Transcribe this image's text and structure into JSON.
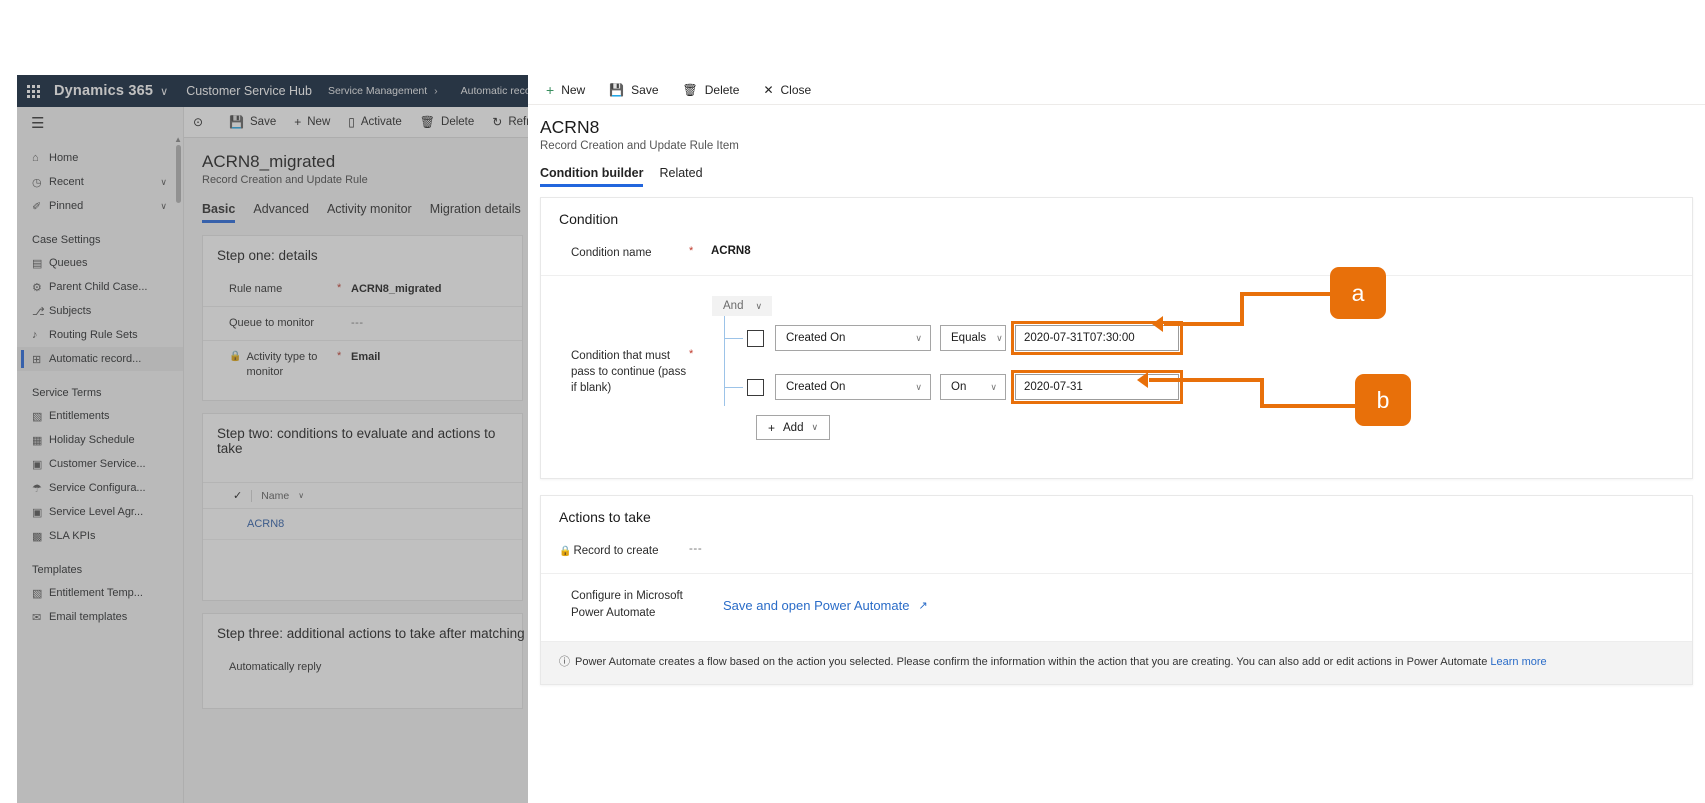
{
  "background_app": {
    "topbar": {
      "waffle_icon": "app-launcher-icon",
      "brand": "Dynamics 365",
      "brand_chevron": "∨",
      "app_name": "Customer Service Hub",
      "breadcrumb_parent": "Service Management",
      "breadcrumb_sep": "›",
      "breadcrumb_current": "Automatic record creation"
    },
    "sidebar": {
      "hamburger_icon": "hamburger-menu-icon",
      "items": [
        {
          "label": "Home",
          "icon": "⌂",
          "chevron": ""
        },
        {
          "label": "Recent",
          "icon": "◷",
          "chevron": "∨"
        },
        {
          "label": "Pinned",
          "icon": "✐",
          "chevron": "∨"
        }
      ],
      "groups": [
        {
          "title": "Case Settings",
          "items": [
            {
              "label": "Queues",
              "icon": "▤"
            },
            {
              "label": "Parent Child Case...",
              "icon": "⚙"
            },
            {
              "label": "Subjects",
              "icon": "⎇"
            },
            {
              "label": "Routing Rule Sets",
              "icon": "♪"
            },
            {
              "label": "Automatic record...",
              "icon": "⊞",
              "selected": true
            }
          ]
        },
        {
          "title": "Service Terms",
          "items": [
            {
              "label": "Entitlements",
              "icon": "▧"
            },
            {
              "label": "Holiday Schedule",
              "icon": "▦"
            },
            {
              "label": "Customer Service...",
              "icon": "▣"
            },
            {
              "label": "Service Configura...",
              "icon": "☂"
            },
            {
              "label": "Service Level Agr...",
              "icon": "▣"
            },
            {
              "label": "SLA KPIs",
              "icon": "▩"
            }
          ]
        },
        {
          "title": "Templates",
          "items": [
            {
              "label": "Entitlement Temp...",
              "icon": "▧"
            },
            {
              "label": "Email templates",
              "icon": "✉"
            }
          ]
        }
      ]
    },
    "command_bar": [
      {
        "label": "",
        "icon": "⊙",
        "name": "history-button"
      },
      {
        "label": "Save",
        "icon": "💾",
        "name": "save-button"
      },
      {
        "label": "New",
        "icon": "+",
        "name": "new-button"
      },
      {
        "label": "Activate",
        "icon": "▯",
        "name": "activate-button"
      },
      {
        "label": "Delete",
        "icon": "🗑",
        "name": "delete-button"
      },
      {
        "label": "Refr",
        "icon": "↻",
        "name": "refresh-button"
      }
    ],
    "record": {
      "title": "ACRN8_migrated",
      "subtitle": "Record Creation and Update Rule",
      "tabs": [
        {
          "label": "Basic",
          "active": true
        },
        {
          "label": "Advanced",
          "active": false
        },
        {
          "label": "Activity monitor",
          "active": false
        },
        {
          "label": "Migration details",
          "active": false
        }
      ]
    },
    "step_one": {
      "title": "Step one: details",
      "fields": [
        {
          "label": "Rule name",
          "required": "*",
          "value": "ACRN8_migrated",
          "muted": false,
          "lock": false
        },
        {
          "label": "Queue to monitor",
          "required": "",
          "value": "---",
          "muted": true,
          "lock": false
        },
        {
          "label": "Activity type to monitor",
          "required": "*",
          "value": "Email",
          "muted": false,
          "lock": true,
          "lock_icon": "lock-icon"
        }
      ]
    },
    "step_two": {
      "title": "Step two: conditions to evaluate and actions to take",
      "grid": {
        "check_icon": "✓",
        "column": "Name",
        "column_chevron": "∨",
        "rows": [
          "ACRN8"
        ]
      }
    },
    "step_three": {
      "title": "Step three: additional actions to take after matching with an existing case",
      "field_label": "Automatically reply"
    }
  },
  "panel": {
    "command_bar": [
      {
        "label": "New",
        "icon": "+",
        "name": "new-button"
      },
      {
        "label": "Save",
        "icon": "💾",
        "name": "save-button"
      },
      {
        "label": "Delete",
        "icon": "🗑",
        "name": "delete-button"
      },
      {
        "label": "Close",
        "icon": "✕",
        "name": "close-button"
      }
    ],
    "title": "ACRN8",
    "subtitle": "Record Creation and Update Rule Item",
    "tabs": [
      {
        "label": "Condition builder",
        "active": true
      },
      {
        "label": "Related",
        "active": false
      }
    ],
    "condition": {
      "card_title": "Condition",
      "name_label": "Condition name",
      "name_required": "*",
      "name_value": "ACRN8",
      "builder_label": "Condition that must pass to continue (pass if blank)",
      "builder_required": "*",
      "group_operator": "And",
      "group_chevron": "∨",
      "rows": [
        {
          "checked": false,
          "attribute": "Created On",
          "operator": "Equals",
          "value": "2020-07-31T07:30:00",
          "highlighted": true
        },
        {
          "checked": false,
          "attribute": "Created On",
          "operator": "On",
          "value": "2020-07-31",
          "highlighted": true
        }
      ],
      "add_button": {
        "plus": "+",
        "label": "Add",
        "chevron": "∨"
      }
    },
    "actions": {
      "card_title": "Actions to take",
      "record_to_create_label": "Record to create",
      "record_to_create_lock": "lock-icon",
      "record_to_create_value": "---",
      "configure_label": "Configure in Microsoft Power Automate",
      "configure_link": "Save and open Power Automate",
      "external_icon": "open-in-new-window-icon",
      "info_icon": "ⓘ",
      "info_text": "Power Automate creates a flow based on the action you selected. Please confirm the information within the action that you are creating. You can also add or edit actions in Power Automate",
      "info_link": "Learn more"
    }
  },
  "callouts": [
    {
      "id": "a",
      "label": "a"
    },
    {
      "id": "b",
      "label": "b"
    }
  ],
  "colors": {
    "accent_orange": "#e8700a",
    "brand_navy": "#0b1f38",
    "tab_underline_blue": "#2266dd",
    "link_blue": "#2a6cc8"
  }
}
